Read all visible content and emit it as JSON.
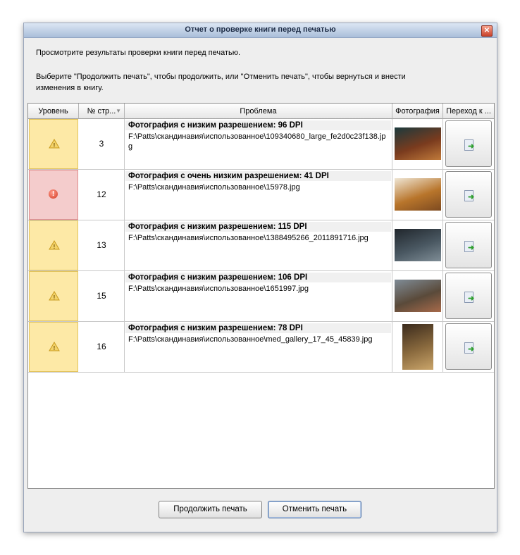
{
  "window": {
    "title": "Отчет о проверке книги перед печатью",
    "message_line1": "Просмотрите результаты проверки книги перед печатью.",
    "message_line2": "Выберите \"Продолжить печать\", чтобы продолжить, или \"Отменить печать\", чтобы вернуться и внести изменения в книгу."
  },
  "table": {
    "columns": [
      "Уровень",
      "№ стр...",
      "Проблема",
      "Фотография",
      "Переход к ..."
    ],
    "rows": [
      {
        "level": "warning",
        "page": "3",
        "issue": "Фотография с низким разрешением: 96 DPI",
        "path": "F:\\Patts\\скандинавия\\использованное\\109340680_large_fe2d0c23f138.jpg",
        "thumb_colors": [
          "#1b3a3d",
          "#7a3b1e",
          "#c07a3a"
        ]
      },
      {
        "level": "error",
        "page": "12",
        "issue": "Фотография с очень низким разрешением: 41 DPI",
        "path": "F:\\Patts\\скандинавия\\использованное\\15978.jpg",
        "thumb_colors": [
          "#efe6d4",
          "#b8752b",
          "#7d4a20"
        ]
      },
      {
        "level": "warning",
        "page": "13",
        "issue": "Фотография с низким разрешением: 115 DPI",
        "path": "F:\\Patts\\скандинавия\\использованное\\1388495266_2011891716.jpg",
        "thumb_colors": [
          "#20262c",
          "#4a5862",
          "#7f8d96"
        ]
      },
      {
        "level": "warning",
        "page": "15",
        "issue": "Фотография с низким разрешением: 106 DPI",
        "path": "F:\\Patts\\скандинавия\\использованное\\1651997.jpg",
        "thumb_colors": [
          "#7f8c97",
          "#5a4a3a",
          "#a86a4a"
        ]
      },
      {
        "level": "warning",
        "page": "16",
        "issue": "Фотография с низким разрешением: 78 DPI",
        "path": "F:\\Patts\\скандинавия\\использованное\\med_gallery_17_45_45839.jpg",
        "thumb_colors": [
          "#3a2a1c",
          "#8a6a3e",
          "#caa56a"
        ]
      }
    ]
  },
  "buttons": {
    "continue": "Продолжить печать",
    "cancel": "Отменить печать"
  }
}
